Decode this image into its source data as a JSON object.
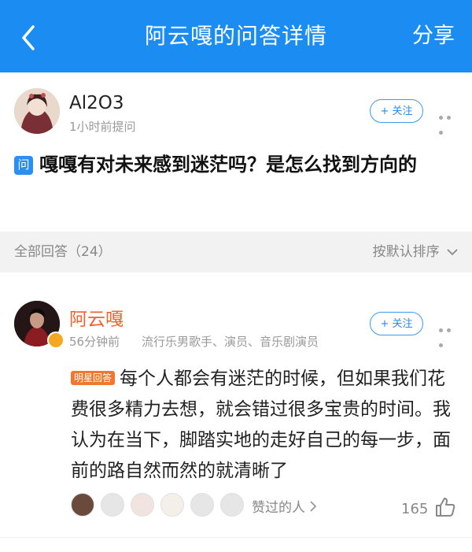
{
  "header": {
    "title": "阿云嘎的问答详情",
    "share_label": "分享",
    "back_icon": "chevron-left-icon"
  },
  "asker": {
    "name": "Al2O3",
    "time": "1小时前提问",
    "follow_label": "+ 关注"
  },
  "question": {
    "badge": "问",
    "text": "嘎嘎有对未来感到迷茫吗？是怎么找到方向的"
  },
  "answers_bar": {
    "count_label": "全部回答（24）",
    "sort_label": "按默认排序"
  },
  "answer": {
    "author": "阿云嘎",
    "time": "56分钟前",
    "tags": "流行乐男歌手、演员、音乐剧演员",
    "follow_label": "+ 关注",
    "badge": "明星回答",
    "text": "每个人都会有迷茫的时候，但如果我们花费很多精力去想，就会错过很多宝贵的时间。我认为在当下，脚踏实地的走好自己的每一步，面前的路自然而然的就清晰了",
    "likers_label": "赞过的人",
    "like_count": "165"
  },
  "colors": {
    "header_bg": "#1b8df2",
    "accent_blue": "#2a89e8",
    "author_orange": "#f0622e",
    "badge_orange": "#f0782e"
  }
}
